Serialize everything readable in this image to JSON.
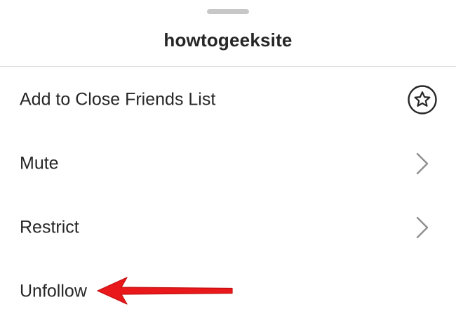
{
  "sheet": {
    "title": "howtogeeksite",
    "items": [
      {
        "label": "Add to Close Friends List",
        "icon": "star-circle-icon"
      },
      {
        "label": "Mute",
        "icon": "chevron-right-icon"
      },
      {
        "label": "Restrict",
        "icon": "chevron-right-icon"
      },
      {
        "label": "Unfollow",
        "icon": ""
      }
    ]
  },
  "annotation": {
    "arrow_color": "#e8181b",
    "icon": "red-arrow-pointer"
  }
}
